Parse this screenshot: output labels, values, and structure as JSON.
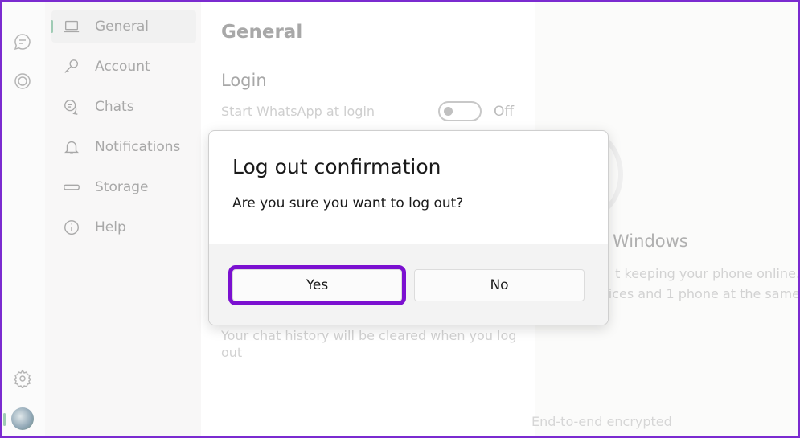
{
  "nav": {
    "items": [
      {
        "label": "General",
        "icon": "laptop-icon"
      },
      {
        "label": "Account",
        "icon": "key-icon"
      },
      {
        "label": "Chats",
        "icon": "chats-icon"
      },
      {
        "label": "Notifications",
        "icon": "bell-icon"
      },
      {
        "label": "Storage",
        "icon": "storage-icon"
      },
      {
        "label": "Help",
        "icon": "info-icon"
      }
    ]
  },
  "settings": {
    "title": "General",
    "section": "Login",
    "start_label": "Start WhatsApp at login",
    "toggle_state": "Off",
    "logout_note": "Your chat history will be cleared when you log out"
  },
  "right": {
    "title": "Windows",
    "desc1": "t keeping your phone online.",
    "desc2": "vices and 1 phone at the same",
    "encrypted": "End-to-end encrypted"
  },
  "dialog": {
    "title": "Log out confirmation",
    "message": "Are you sure you want to log out?",
    "yes": "Yes",
    "no": "No"
  },
  "colors": {
    "highlight": "#7b10d0",
    "accent": "#9fcbb4"
  }
}
